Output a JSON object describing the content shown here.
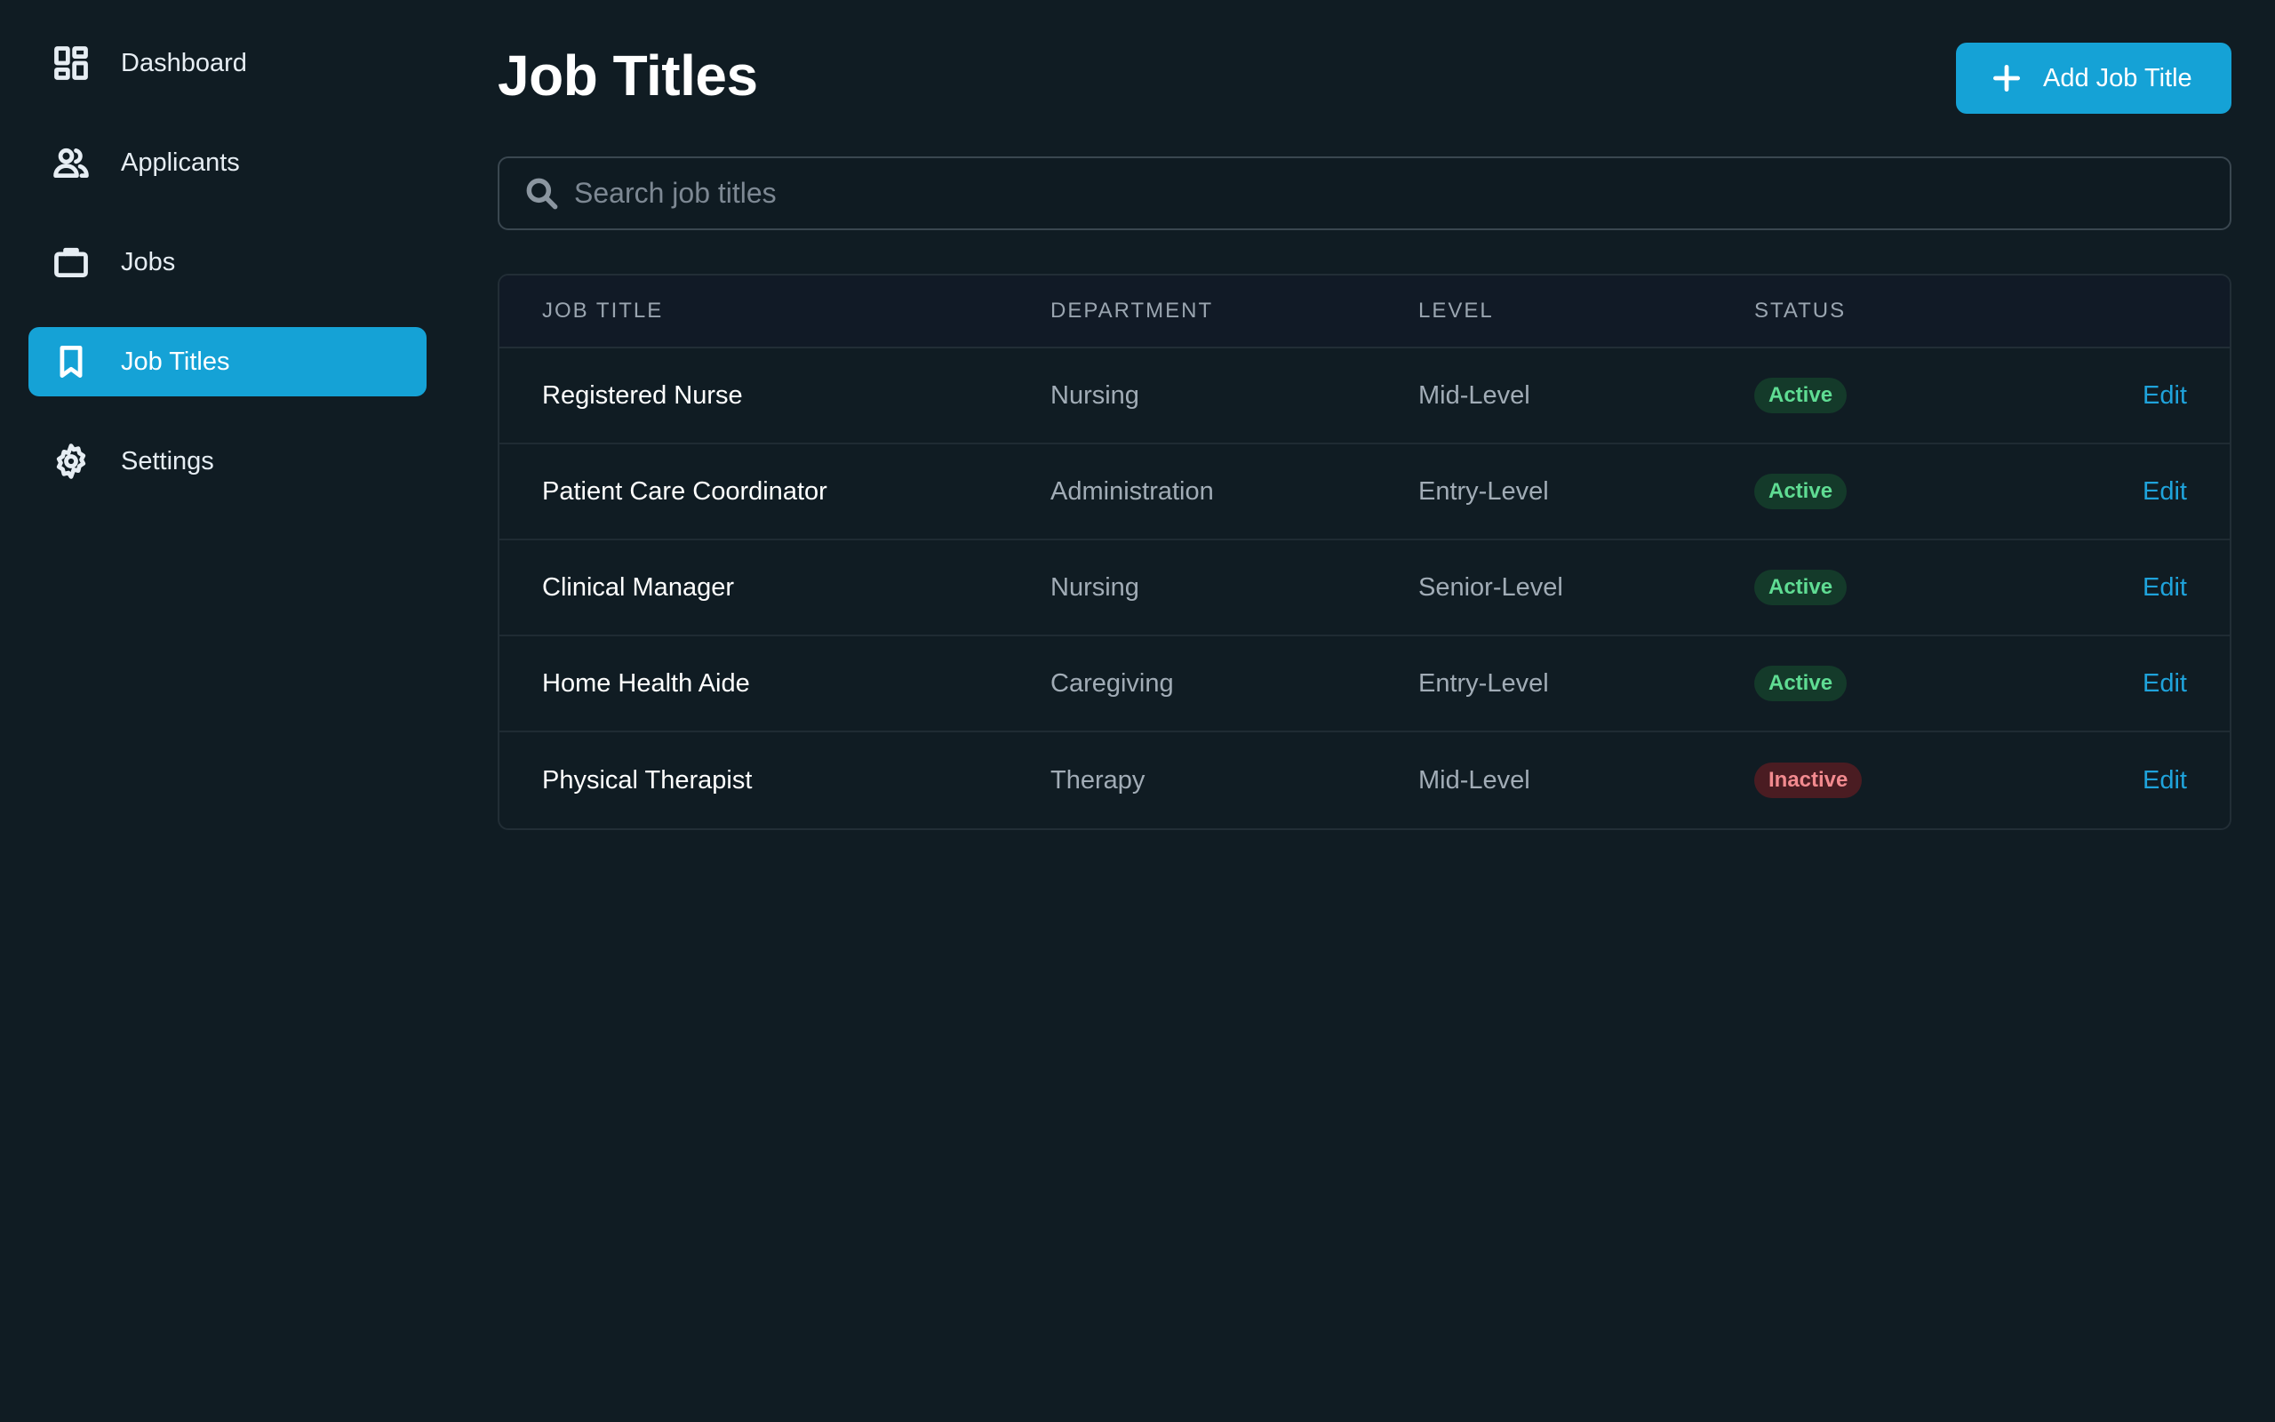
{
  "sidebar": {
    "items": [
      {
        "label": "Dashboard",
        "icon": "dashboard-icon"
      },
      {
        "label": "Applicants",
        "icon": "users-icon"
      },
      {
        "label": "Jobs",
        "icon": "briefcase-icon"
      },
      {
        "label": "Job Titles",
        "icon": "bookmark-icon",
        "active": true
      },
      {
        "label": "Settings",
        "icon": "gear-icon"
      }
    ]
  },
  "header": {
    "title": "Job Titles",
    "add_button_label": "Add Job Title"
  },
  "search": {
    "placeholder": "Search job titles",
    "value": ""
  },
  "table": {
    "columns": [
      "JOB TITLE",
      "DEPARTMENT",
      "LEVEL",
      "STATUS"
    ],
    "rows": [
      {
        "title": "Registered Nurse",
        "department": "Nursing",
        "level": "Mid-Level",
        "status": "Active",
        "action": "Edit"
      },
      {
        "title": "Patient Care Coordinator",
        "department": "Administration",
        "level": "Entry-Level",
        "status": "Active",
        "action": "Edit"
      },
      {
        "title": "Clinical Manager",
        "department": "Nursing",
        "level": "Senior-Level",
        "status": "Active",
        "action": "Edit"
      },
      {
        "title": "Home Health Aide",
        "department": "Caregiving",
        "level": "Entry-Level",
        "status": "Active",
        "action": "Edit"
      },
      {
        "title": "Physical Therapist",
        "department": "Therapy",
        "level": "Mid-Level",
        "status": "Inactive",
        "action": "Edit"
      }
    ]
  },
  "colors": {
    "background": "#101c23",
    "accent": "#15a2d6",
    "active_badge_bg": "#143a2a",
    "active_badge_text": "#5fdc93",
    "inactive_badge_bg": "#4a1c22",
    "inactive_badge_text": "#f28a8f",
    "link": "#1fa3db"
  }
}
